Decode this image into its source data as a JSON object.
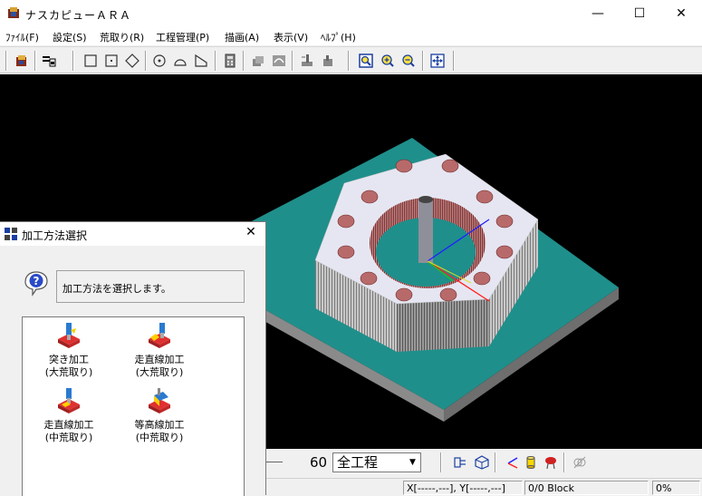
{
  "window": {
    "title": "ナスカピューＡＲＡ",
    "minimize": "—",
    "maximize": "☐",
    "close": "✕"
  },
  "menu": [
    {
      "label": "ﾌｧｲﾙ(F)"
    },
    {
      "label": "設定(S)"
    },
    {
      "label": "荒取り(R)"
    },
    {
      "label": "工程管理(P)"
    },
    {
      "label": "描画(A)"
    },
    {
      "label": "表示(V)"
    },
    {
      "label": "ﾍﾙﾌﾟ(H)"
    }
  ],
  "toolbar": {
    "icons": [
      "open-icon",
      "print-icon",
      "rect-icon",
      "square-point-icon",
      "diamond-icon",
      "circle-point-icon",
      "arc-icon",
      "chamfer-icon",
      "calculator-icon",
      "layers-icon",
      "tool-path-icon",
      "cut-tool-icon",
      "move-icon",
      "zoom-fit-icon",
      "zoom-in-icon",
      "zoom-out-icon",
      "pan-icon"
    ]
  },
  "bottom_toolbar": {
    "step_value": "60",
    "process_select": "全工程",
    "icons": [
      "tool-holder-icon",
      "cube-view-icon",
      "axis-icon",
      "cylinder-icon",
      "red-tool-icon",
      "hide-icon"
    ]
  },
  "status": {
    "coords": "X[-----,---], Y[-----,---]",
    "block": "0/0 Block",
    "percent": "0%"
  },
  "dialog": {
    "title": "加工方法選択",
    "close": "✕",
    "message": "加工方法を選択します。",
    "operations": [
      {
        "line1": "突き加工",
        "line2": "(大荒取り)",
        "icon": "plunge-icon"
      },
      {
        "line1": "走直線加工",
        "line2": "(大荒取り)",
        "icon": "line-scan-icon"
      },
      {
        "line1": "走直線加工",
        "line2": "(中荒取り)",
        "icon": "line-scan-mid-icon"
      },
      {
        "line1": "等高線加工",
        "line2": "(中荒取り)",
        "icon": "contour-icon"
      }
    ]
  },
  "colors": {
    "viewport_bg": "#000000",
    "plate_top": "#1f8f8b",
    "plate_side": "#777777",
    "hex_top": "#e6e6f2",
    "hole": "#b05a5a"
  }
}
